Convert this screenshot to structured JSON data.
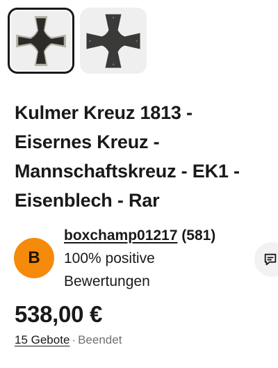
{
  "gallery": {
    "images": [
      {
        "icon": "iron-cross-front-icon",
        "selected": true
      },
      {
        "icon": "iron-cross-back-icon",
        "selected": false
      }
    ]
  },
  "listing": {
    "title_lines": [
      "Kulmer Kreuz 1813 -",
      "Eisernes Kreuz -",
      "Mannschaftskreuz - EK1 -",
      "Eisenblech - Rar"
    ]
  },
  "seller": {
    "avatar_initial": "B",
    "avatar_color": "#f58a0b",
    "name": "boxchamp01217",
    "feedback_count": "(581)",
    "feedback_line1": "100% positive",
    "feedback_line2": "Bewertungen",
    "message_icon": "chat-icon"
  },
  "pricing": {
    "price": "538,00 €",
    "bids": "15 Gebote",
    "separator": "·",
    "status": "Beendet"
  }
}
